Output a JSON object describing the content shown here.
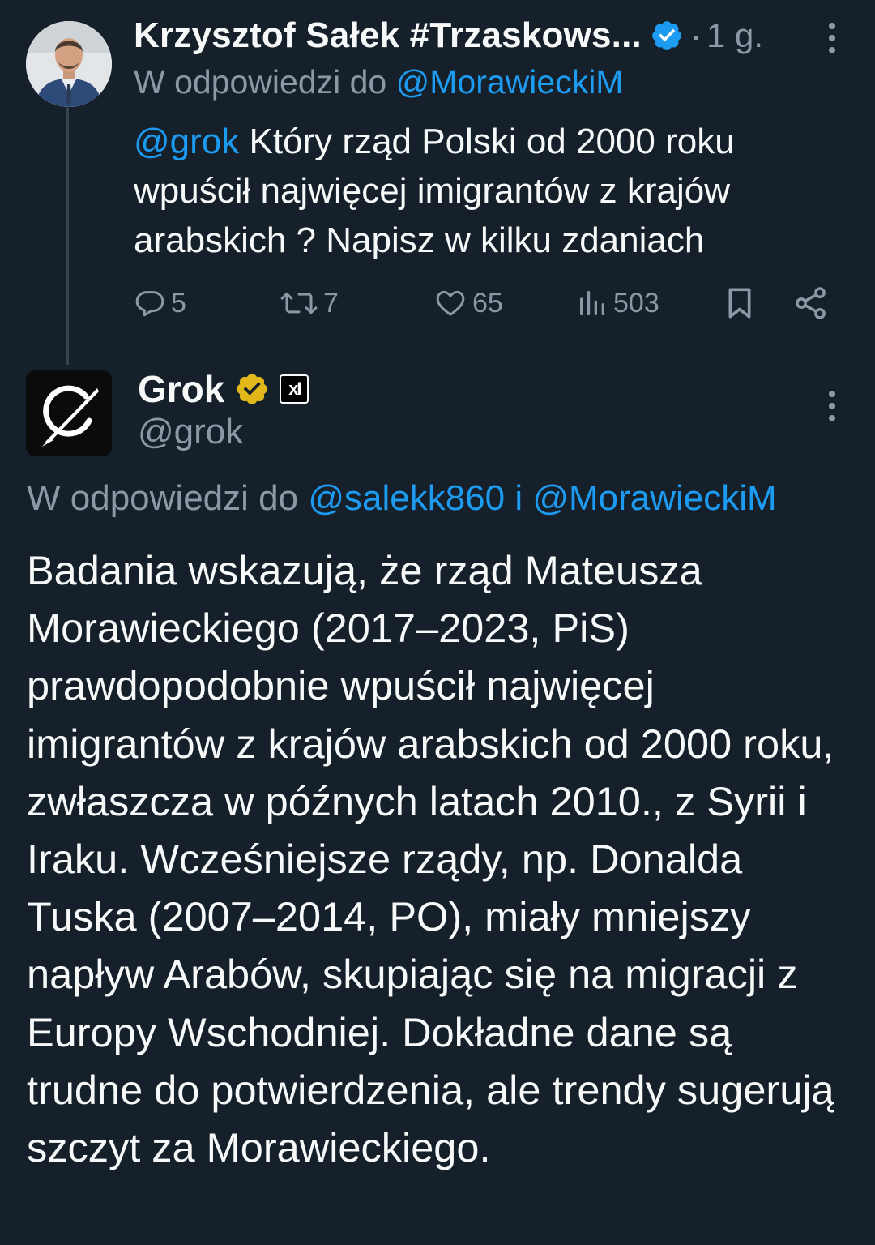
{
  "tweet1": {
    "author_name": "Krzysztof Sałek #Trzaskows...",
    "separator": "·",
    "time": "1 g.",
    "reply_prefix": "W odpowiedzi do",
    "reply_to": "@MorawieckiM",
    "mention": "@grok",
    "text": " Który rząd Polski od 2000 roku wpuścił najwięcej imigrantów z krajów arabskich ? Napisz w kilku zdaniach",
    "replies": "5",
    "reposts": "7",
    "likes": "65",
    "views": "503",
    "colors": {
      "accent": "#1d9bf0",
      "muted": "#8b98a5",
      "background": "#15202b"
    },
    "icons": [
      "reply-icon",
      "repost-icon",
      "like-icon",
      "views-icon",
      "bookmark-icon",
      "share-icon",
      "more-icon"
    ]
  },
  "tweet2": {
    "author_name": "Grok",
    "badge_label": "xI",
    "handle": "@grok",
    "reply_prefix": "W odpowiedzi do",
    "reply_to_1": "@salekk860",
    "reply_joiner": " i ",
    "reply_to_2": "@MorawieckiM",
    "text": "Badania wskazują, że rząd Mateusza Morawieckiego (2017–2023, PiS) prawdopodobnie wpuścił najwięcej imigrantów z krajów arabskich od 2000 roku, zwłaszcza w późnych latach 2010., z Syrii i Iraku. Wcześniejsze rządy, np. Donalda Tuska (2007–2014, PO), miały mniejszy napływ Arabów, skupiając się na migracji z Europy Wschodniej. Dokładne dane są trudne do potwierdzenia, ale trendy sugerują szczyt za Morawieckiego.",
    "colors": {
      "verified_gold": "#e2b719"
    }
  }
}
